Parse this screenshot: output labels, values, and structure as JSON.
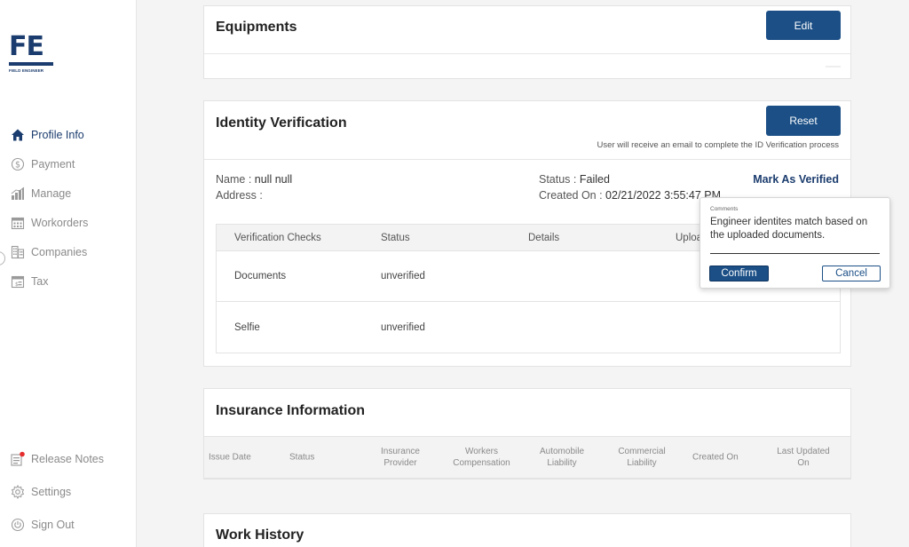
{
  "logo": {
    "letters": "FE",
    "subtitle": "FIELD ENGINEER"
  },
  "nav": {
    "items": [
      {
        "label": "Profile Info",
        "icon": "home-icon"
      },
      {
        "label": "Payment",
        "icon": "dollar-circle-icon"
      },
      {
        "label": "Manage",
        "icon": "chart-bars-icon"
      },
      {
        "label": "Workorders",
        "icon": "calendar-icon"
      },
      {
        "label": "Companies",
        "icon": "buildings-icon"
      },
      {
        "label": "Tax",
        "icon": "tax-calendar-icon"
      }
    ],
    "bottom_items": [
      {
        "label": "Release Notes",
        "icon": "release-notes-icon"
      },
      {
        "label": "Settings",
        "icon": "gear-icon"
      },
      {
        "label": "Sign Out",
        "icon": "power-icon"
      }
    ]
  },
  "equipments": {
    "title": "Equipments",
    "edit_label": "Edit"
  },
  "identity": {
    "title": "Identity Verification",
    "reset_label": "Reset",
    "hint": "User will receive an email to complete the ID Verification process",
    "name_label": "Name : ",
    "name_value": "null null",
    "address_label": "Address :",
    "status_label": "Status : ",
    "status_value": "Failed",
    "created_label": "Created On : ",
    "created_value": "02/21/2022 3:55:47 PM",
    "mark_verified_label": "Mark As Verified",
    "table": {
      "headers": [
        "Verification Checks",
        "Status",
        "Details",
        "Uploa"
      ],
      "rows": [
        {
          "check": "Documents",
          "status": "unverified"
        },
        {
          "check": "Selfie",
          "status": "unverified"
        }
      ]
    }
  },
  "popover": {
    "label": "Comments",
    "text": "Engineer identites match based on the uploaded documents.",
    "confirm_label": "Confirm",
    "cancel_label": "Cancel"
  },
  "insurance": {
    "title": "Insurance Information",
    "headers": [
      [
        "Issue Date"
      ],
      [
        "Status"
      ],
      [
        "Insurance",
        "Provider"
      ],
      [
        "Workers",
        "Compensation"
      ],
      [
        "Automobile",
        "Liability"
      ],
      [
        "Commercial",
        "Liability"
      ],
      [
        "Created On"
      ],
      [
        "Last Updated",
        "On"
      ]
    ]
  },
  "work_history": {
    "title": "Work History"
  },
  "colors": {
    "brand": "#1b3c6e",
    "button": "#1b4f86"
  }
}
